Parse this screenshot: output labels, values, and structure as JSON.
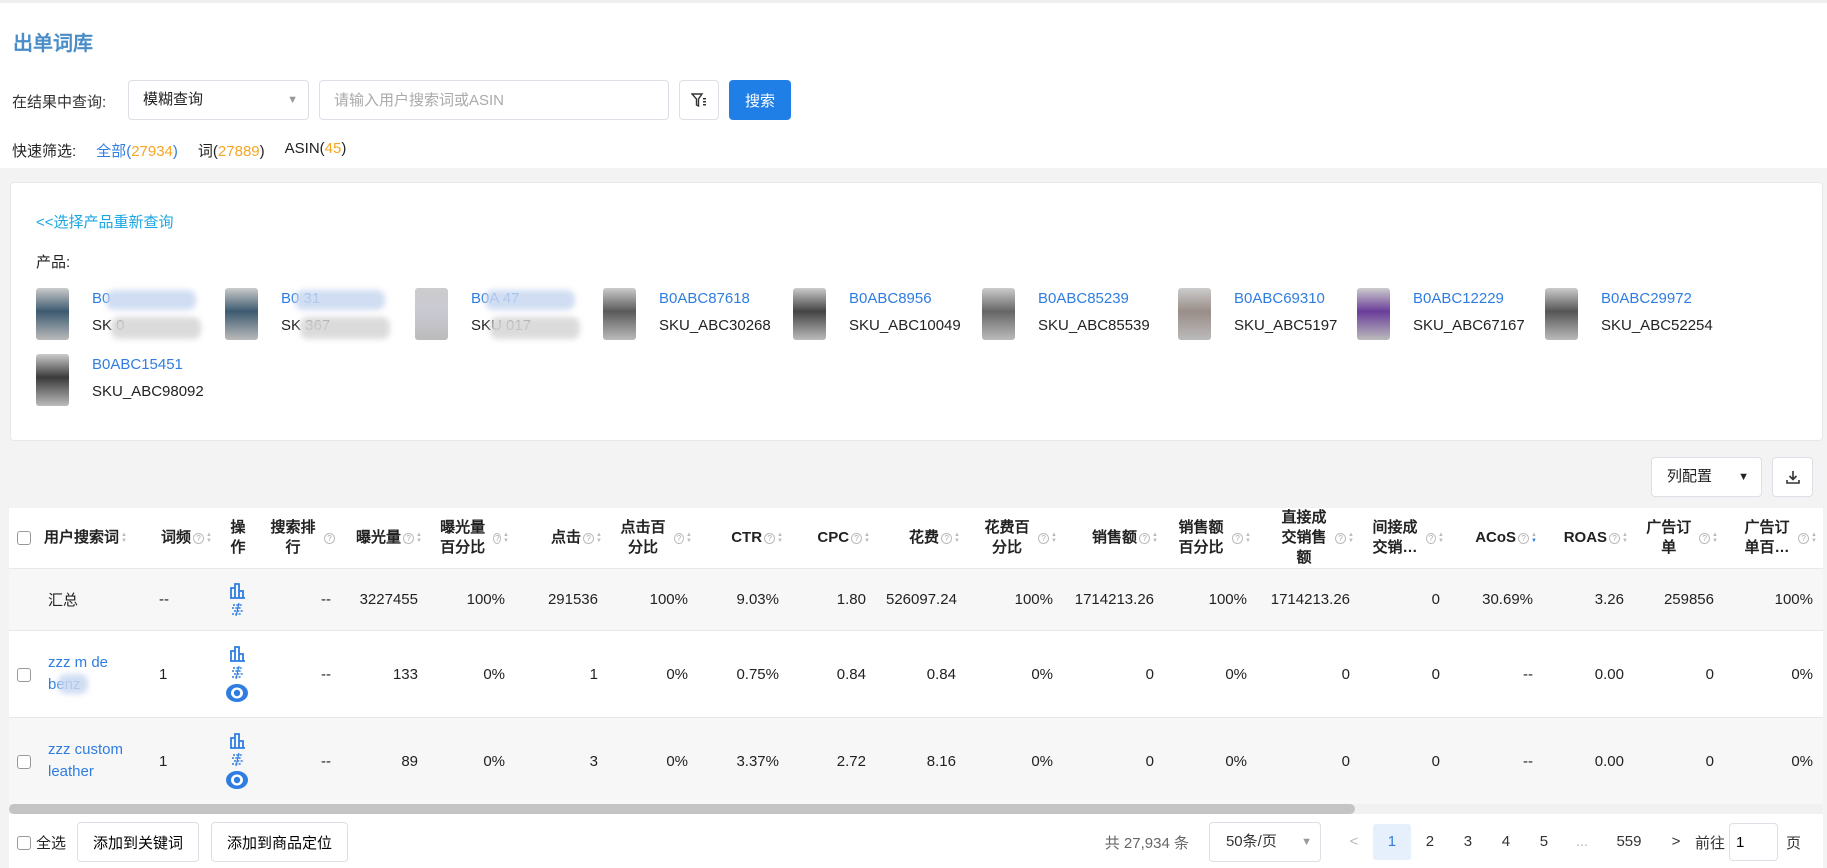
{
  "header": {
    "title": "出单词库"
  },
  "search": {
    "label": "在结果中查询:",
    "mode": "模糊查询",
    "placeholder": "请输入用户搜索词或ASIN",
    "button": "搜索"
  },
  "quick_filter": {
    "label": "快速筛选:",
    "items": [
      {
        "label": "全部",
        "count": "27934"
      },
      {
        "label": "词",
        "count": "27889"
      },
      {
        "label": "ASIN",
        "count": "45"
      }
    ]
  },
  "products": {
    "back_link": "<<选择产品重新查询",
    "label": "产品:",
    "items": [
      {
        "asin": "B0",
        "sku": "SK                0",
        "color": "#3c5a70"
      },
      {
        "asin": "B0           31",
        "sku": "SK           367",
        "color": "#3c5a70"
      },
      {
        "asin": "B0A          47",
        "sku": "SKU          017",
        "color": "#c9c9d4"
      },
      {
        "asin": "B0ABC87618",
        "sku": "SKU_ABC30268",
        "color": "#5a5a5a"
      },
      {
        "asin": "B0ABC8956",
        "sku": "SKU_ABC10049",
        "color": "#444"
      },
      {
        "asin": "B0ABC85239",
        "sku": "SKU_ABC85539",
        "color": "#666"
      },
      {
        "asin": "B0ABC69310",
        "sku": "SKU_ABC5197",
        "color": "#998d88"
      },
      {
        "asin": "B0ABC12229",
        "sku": "SKU_ABC67167",
        "color": "#6a3d9a"
      },
      {
        "asin": "B0ABC29972",
        "sku": "SKU_ABC52254",
        "color": "#555"
      },
      {
        "asin": "B0ABC15451",
        "sku": "SKU_ABC98092",
        "color": "#3a3a3a"
      }
    ]
  },
  "toolbar": {
    "column_config": "列配置",
    "download_icon": "download-icon"
  },
  "table": {
    "columns": [
      "用户搜索词",
      "词频",
      "操作",
      "搜索排行",
      "曝光量",
      "曝光量百分比",
      "点击",
      "点击百分比",
      "CTR",
      "CPC",
      "花费",
      "花费百分比",
      "销售额",
      "销售额百分比",
      "直接成交销售额",
      "间接成交销…",
      "ACoS",
      "ROAS",
      "广告订单",
      "广告订单百…"
    ],
    "summary": [
      "汇总",
      "--",
      "",
      "--",
      "3227455",
      "100%",
      "291536",
      "100%",
      "9.03%",
      "1.80",
      "526097.24",
      "100%",
      "1714213.26",
      "100%",
      "1714213.26",
      "0",
      "30.69%",
      "3.26",
      "259856",
      "100%"
    ],
    "rows": [
      [
        "zzz m   de benz",
        "1",
        "",
        "--",
        "133",
        "0%",
        "1",
        "0%",
        "0.75%",
        "0.84",
        "0.84",
        "0%",
        "0",
        "0%",
        "0",
        "0",
        "--",
        "0.00",
        "0",
        "0%"
      ],
      [
        "zzz custom leather",
        "1",
        "",
        "--",
        "89",
        "0%",
        "3",
        "0%",
        "3.37%",
        "2.72",
        "8.16",
        "0%",
        "0",
        "0%",
        "0",
        "0",
        "--",
        "0.00",
        "0",
        "0%"
      ]
    ],
    "sorted_column": "ACoS",
    "sort_direction": "descending"
  },
  "footer": {
    "select_all": "全选",
    "add_keyword": "添加到关键词",
    "add_product_target": "添加到商品定位"
  },
  "pagination": {
    "total": "共 27,934 条",
    "page_size": "50条/页",
    "prev": "<",
    "pages": [
      "1",
      "2",
      "3",
      "4",
      "5"
    ],
    "ellipsis": "...",
    "last": "559",
    "next": ">",
    "goto_label": "前往",
    "goto_value": "1",
    "goto_suffix": "页",
    "current": "1"
  },
  "colors": {
    "accent": "#1f7fe6",
    "link": "#2f7de1",
    "count": "#f5a623",
    "back_link": "#19a6e3"
  }
}
